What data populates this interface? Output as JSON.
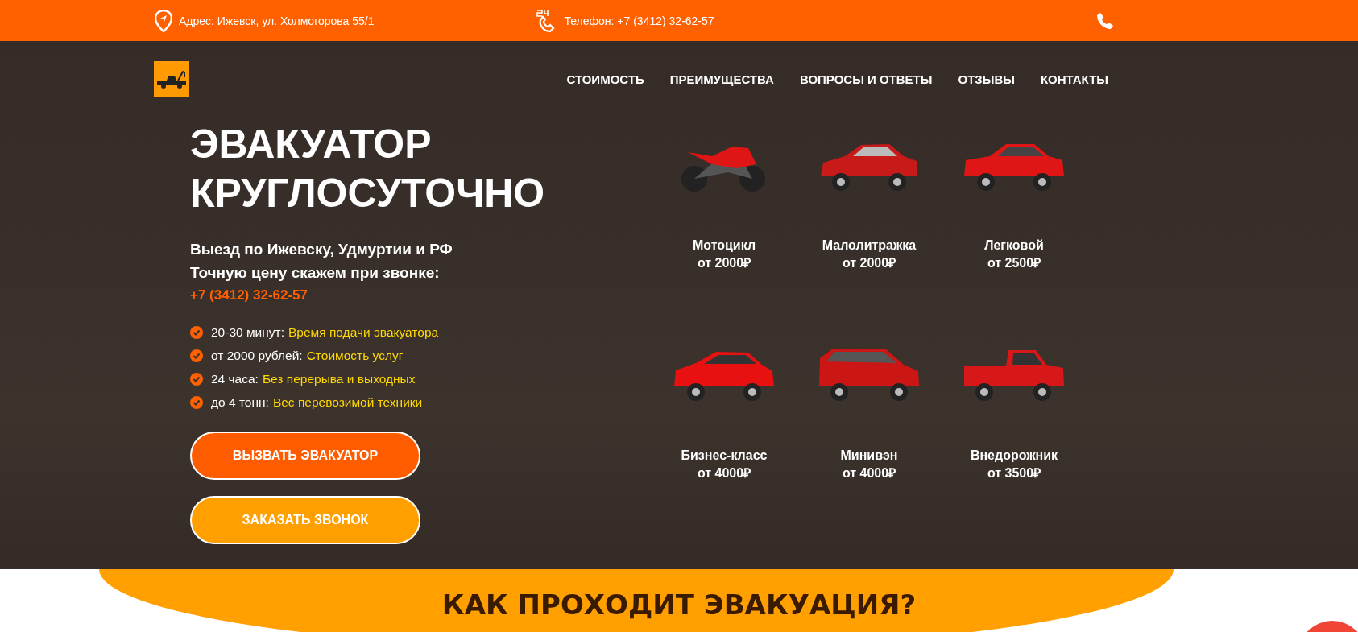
{
  "top_bar": {
    "address": "Адрес: Ижевск, ул. Холмогорова 55/1",
    "phone": "Телефон: +7 (3412) 32-62-57"
  },
  "nav": [
    "СТОИМОСТЬ",
    "ПРЕИМУЩЕСТВА",
    "ВОПРОСЫ И ОТВЕТЫ",
    "ОТЗЫВЫ",
    "КОНТАКТЫ"
  ],
  "hero": {
    "title": "ЭВАКУАТОР КРУГЛОСУТОЧНО",
    "subtitle": "Выезд по Ижевску, Удмуртии и РФ",
    "price_note": "Точную цену скажем при звонке:",
    "phone": "+7 (3412) 32-62-57",
    "features": [
      {
        "fact": "20-30 минут:",
        "description": "Время подачи эвакуатора"
      },
      {
        "fact": "от 2000 рублей:",
        "description": "Стоимость услуг"
      },
      {
        "fact": "24 часа:",
        "description": "Без перерыва и выходных"
      },
      {
        "fact": "до 4 тонн:",
        "description": "Вес перевозимой техники"
      }
    ],
    "buttons": [
      {
        "label": "ВЫЗВАТЬ ЭВАКУАТОР",
        "kind": "primary"
      },
      {
        "label": "ЗАКАЗАТЬ ЗВОНОК",
        "kind": "secondary"
      }
    ]
  },
  "vehicles": [
    {
      "kind": "motorcycle",
      "name": "Мотоцикл",
      "price": "от 2000₽"
    },
    {
      "kind": "hatchback",
      "name": "Малолитражка",
      "price": "от 2000₽"
    },
    {
      "kind": "sedan",
      "name": "Легковой",
      "price": "от 2500₽"
    },
    {
      "kind": "suv",
      "name": "Бизнес-класс",
      "price": "от 4000₽"
    },
    {
      "kind": "minivan",
      "name": "Минивэн",
      "price": "от 4000₽"
    },
    {
      "kind": "pickup",
      "name": "Внедорожник",
      "price": "от 3500₽"
    }
  ],
  "section": {
    "title": "КАК ПРОХОДИТ ЭВАКУАЦИЯ?"
  }
}
